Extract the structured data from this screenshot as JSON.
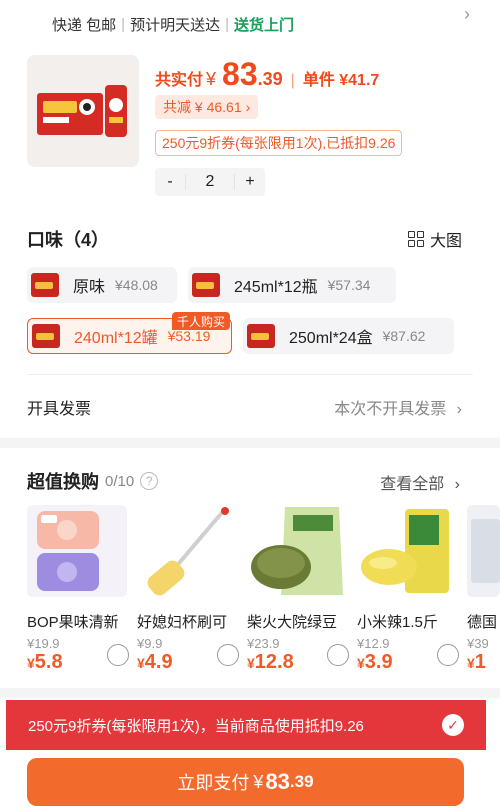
{
  "shipping": {
    "express": "快递 包邮",
    "eta": "预计明天送达",
    "door": "送货上门",
    "colors": {
      "door": "#19a05a"
    }
  },
  "product": {
    "image_icon": "product-box-image",
    "total_label": "共实付",
    "currency": "¥",
    "total_int": "83",
    "total_dec": ".39",
    "unit_label": "单件 ¥41.7",
    "saving": "共减 ¥ 46.61",
    "coupon": "250元9折券(每张限用1次),已抵扣9.26",
    "quantity": "2",
    "minus": "-",
    "plus": "+",
    "accent": "#f04a1a"
  },
  "flavor": {
    "title": "口味（4）",
    "big_view": "大图",
    "options": [
      {
        "label": "原味",
        "price": "¥48.08"
      },
      {
        "label": "245ml*12瓶",
        "price": "¥57.34"
      },
      {
        "label": "240ml*12罐",
        "price": "¥53.19",
        "badge": "千人购买",
        "selected": true
      },
      {
        "label": "250ml*24盒",
        "price": "¥87.62"
      }
    ]
  },
  "invoice": {
    "label": "开具发票",
    "value": "本次不开具发票"
  },
  "swap": {
    "title": "超值换购",
    "count": "0/10",
    "help": "?",
    "see_all": "查看全部",
    "items": [
      {
        "name": "BOP果味清新",
        "orig": "¥19.9",
        "cur": "¥",
        "now": "5.8"
      },
      {
        "name": "好媳妇杯刷可",
        "orig": "¥9.9",
        "cur": "¥",
        "now": "4.9"
      },
      {
        "name": "柴火大院绿豆",
        "orig": "¥23.9",
        "cur": "¥",
        "now": "12.8"
      },
      {
        "name": "小米辣1.5斤",
        "orig": "¥12.9",
        "cur": "¥",
        "now": "3.9"
      },
      {
        "name": "德国",
        "orig": "¥39",
        "cur": "¥",
        "now": "1"
      }
    ]
  },
  "banner": {
    "text": "250元9折券(每张限用1次)，当前商品使用抵扣9.26",
    "color": "#e4373b"
  },
  "pay": {
    "label": "立即支付",
    "currency": "¥",
    "amount_int": "83",
    "amount_dec": ".39",
    "color": "#f26a2c"
  }
}
